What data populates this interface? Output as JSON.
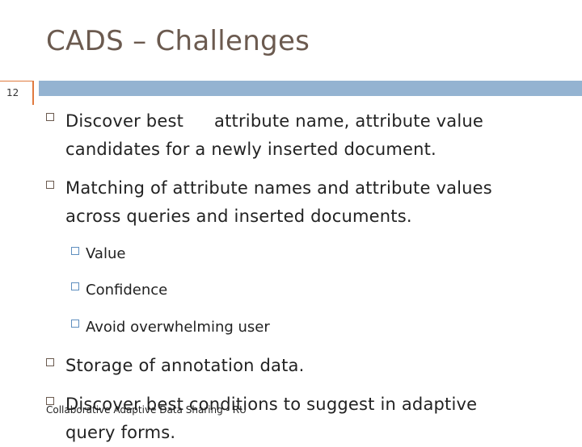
{
  "slide": {
    "title": "CADS – Challenges",
    "number": "12",
    "footer": "Collaborative Adaptive Data Sharing - RU"
  },
  "bullets": [
    {
      "line1_a": "Discover best",
      "line1_b": "attribute name, attribute value",
      "line2": "candidates for a newly inserted document."
    },
    {
      "line1": "Matching of attribute names and attribute values",
      "line2": "across queries and inserted documents.",
      "subitems": [
        "Value",
        "Confidence",
        "Avoid overwhelming user"
      ]
    },
    {
      "line1": "Storage of annotation data."
    },
    {
      "line1": "Discover best conditions to suggest in adaptive",
      "line2": "query forms."
    }
  ]
}
